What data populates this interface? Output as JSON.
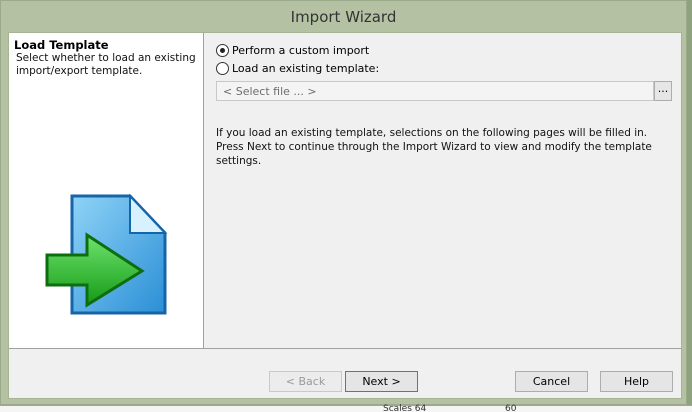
{
  "window": {
    "title": "Import Wizard"
  },
  "left_pane": {
    "heading": "Load Template",
    "description": "Select whether to load an existing import/export template.",
    "icon": "document-import-icon"
  },
  "options": {
    "custom_import_label": "Perform a custom import",
    "custom_import_selected": true,
    "existing_template_label": "Load an existing template:",
    "existing_template_selected": false
  },
  "file_select": {
    "placeholder": "< Select file ... >",
    "browse_label": "..."
  },
  "info_text": "If you load an existing template, selections on the following pages will be filled in.  Press Next to continue through the Import Wizard to view and modify the template settings.",
  "buttons": {
    "back": "< Back",
    "next": "Next >",
    "cancel": "Cancel",
    "help": "Help"
  },
  "background": {
    "fragment_1": "Scales 64",
    "fragment_2": "60"
  },
  "colors": {
    "window_frame": "#b4c2a3",
    "client_bg": "#f0f0f0",
    "icon_doc": "#4aa8e0",
    "icon_arrow": "#2db52d"
  }
}
